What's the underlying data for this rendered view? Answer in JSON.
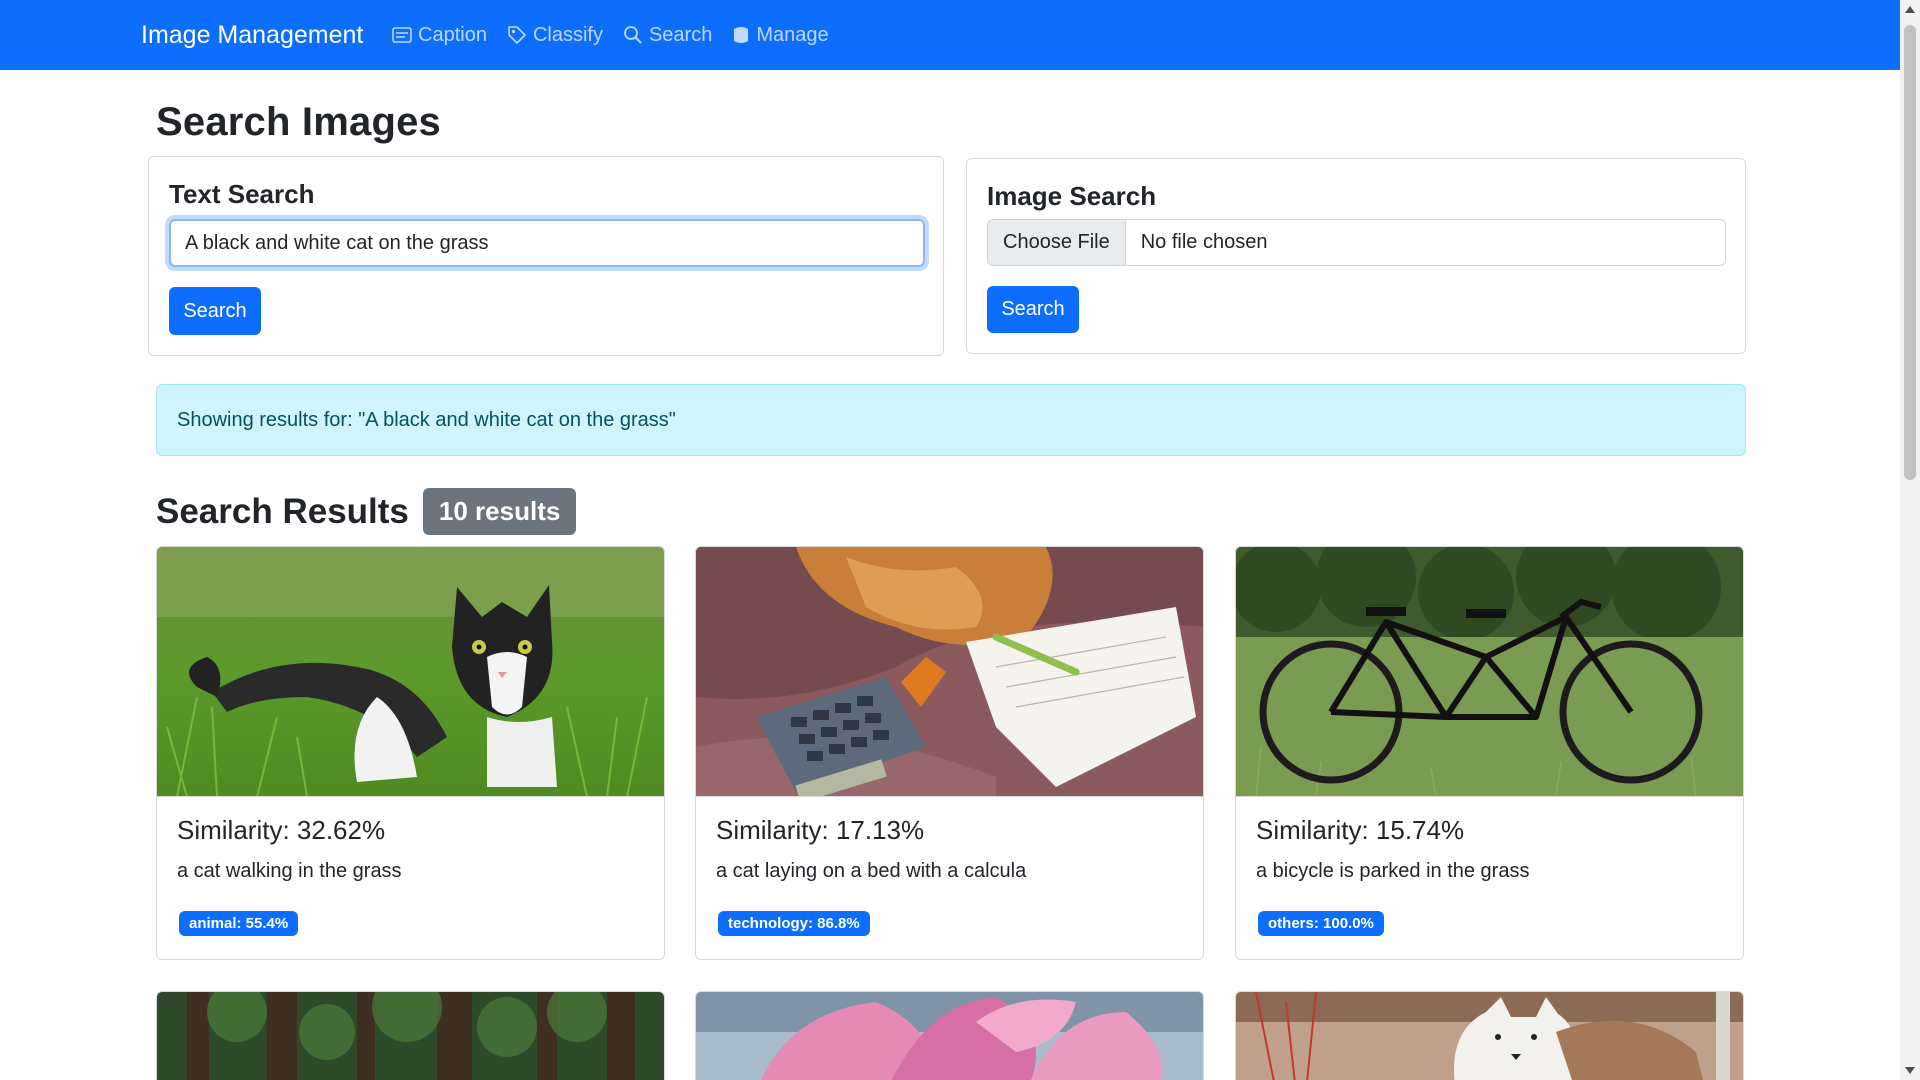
{
  "navbar": {
    "brand": "Image Management",
    "links": [
      {
        "label": "Caption",
        "icon": "caption-icon"
      },
      {
        "label": "Classify",
        "icon": "tag-icon"
      },
      {
        "label": "Search",
        "icon": "search-icon"
      },
      {
        "label": "Manage",
        "icon": "database-icon"
      }
    ]
  },
  "page": {
    "title": "Search Images"
  },
  "text_search": {
    "title": "Text Search",
    "query": "A black and white cat on the grass",
    "button": "Search"
  },
  "image_search": {
    "title": "Image Search",
    "choose_file": "Choose File",
    "file_status": "No file chosen",
    "button": "Search"
  },
  "alert": {
    "text": "Showing results for: \"A black and white cat on the grass\""
  },
  "results": {
    "title": "Search Results",
    "count": "10 results",
    "items": [
      {
        "similarity": "Similarity: 32.62%",
        "caption": "a cat walking in the grass",
        "tag": "animal: 55.4%"
      },
      {
        "similarity": "Similarity: 17.13%",
        "caption": "a cat laying on a bed with a calcula",
        "tag": "technology: 86.8%"
      },
      {
        "similarity": "Similarity: 15.74%",
        "caption": "a bicycle is parked in the grass",
        "tag": "others: 100.0%"
      }
    ]
  },
  "colors": {
    "primary": "#0d6efd",
    "alert_bg": "#cff4fc",
    "badge": "#6c757d"
  }
}
